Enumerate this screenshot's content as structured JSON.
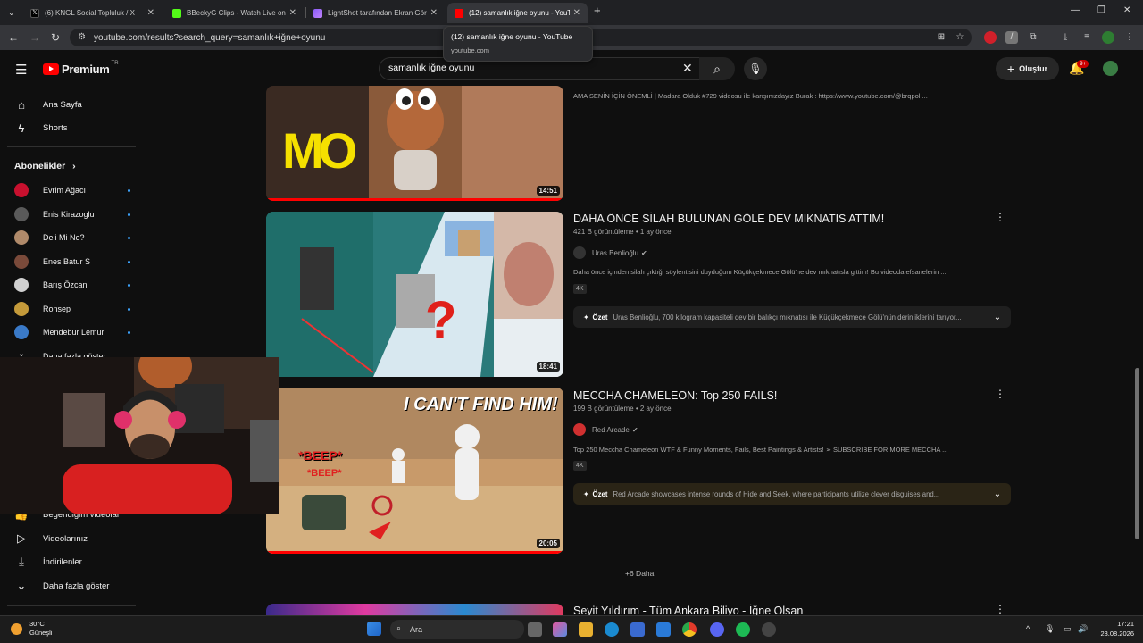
{
  "browser": {
    "tabs": [
      {
        "label": "(6) KNGL Social Topluluk / X",
        "close": "✕"
      },
      {
        "label": "BBeckyG Clips - Watch Live on K",
        "close": "✕"
      },
      {
        "label": "LightShot tarafından Ekran Görü",
        "close": "✕"
      },
      {
        "label": "(12) samanlık iğne oyunu - YouT",
        "close": "✕"
      }
    ],
    "new_tab": "+",
    "url": "youtube.com/results?search_query=samanlık+iğne+oyunu",
    "tooltip": {
      "title": "(12) samanlık iğne oyunu - YouTube",
      "domain": "youtube.com"
    }
  },
  "youtube": {
    "logo_text": "Premium",
    "logo_sup": "TR",
    "search": {
      "value": "samanlık iğne oyunu"
    },
    "create_label": "Oluştur",
    "notif_badge": "9+"
  },
  "sidebar": {
    "nav": [
      {
        "label": "Ana Sayfa",
        "icon": "home-icon"
      },
      {
        "label": "Shorts",
        "icon": "shorts-icon"
      }
    ],
    "subs_header": "Abonelikler",
    "subs": [
      {
        "name": "Evrim Ağacı",
        "color": "#c8102e"
      },
      {
        "name": "Enis Kirazoglu",
        "color": "#5a5a5a"
      },
      {
        "name": "Deli Mi Ne?",
        "color": "#b08a6a"
      },
      {
        "name": "Enes Batur S",
        "color": "#7a4a3a"
      },
      {
        "name": "Barış Özcan",
        "color": "#d0d0d0"
      },
      {
        "name": "Ronsep",
        "color": "#c49a3a"
      },
      {
        "name": "Mendebur Lemur",
        "color": "#3a7ac8"
      }
    ],
    "show_more_partial": "Daha fazla göster",
    "library": [
      {
        "label": "Beğendiğim videolar",
        "icon": "thumbs-up-icon"
      },
      {
        "label": "Videolarınız",
        "icon": "video-icon"
      },
      {
        "label": "İndirilenler",
        "icon": "download-icon"
      },
      {
        "label": "Daha fazla göster",
        "icon": "chevron-down-icon"
      }
    ]
  },
  "videos": [
    {
      "title": "",
      "meta": "",
      "channel": "",
      "desc": "AMA SENİN İÇİN ÖNEMLİ | Madara Olduk #729 videosu ile karışınızdayız Burak : https://www.youtube.com/@brqpol ...",
      "duration": "14:51"
    },
    {
      "title": "DAHA ÖNCE SİLAH BULUNAN GÖLE DEV MIKNATIS ATTIM!",
      "meta": "421 B görüntüleme • 1 ay önce",
      "channel": "Uras Benlioğlu",
      "desc": "Daha önce içinden silah çıktığı söylentisini duyduğum Küçükçekmece Gölü'ne dev mıknatısla gittim! Bu videoda efsanelerin ...",
      "badge": "4K",
      "summary_label": "Özet",
      "summary": "Uras Benlioğlu, 700 kilogram kapasiteli dev bir balıkçı mıknatısı ile Küçükçekmece Gölü'nün derinliklerini tarıyor...",
      "duration": "18:41"
    },
    {
      "title": "MECCHA CHAMELEON: Top 250 FAILS!",
      "meta": "199 B görüntüleme • 2 ay önce",
      "channel": "Red Arcade",
      "desc": "Top 250 Meccha Chameleon WTF & Funny Moments, Fails, Best Paintings & Artists! ➢ SUBSCRIBE FOR MORE MECCHA ...",
      "badge": "4K",
      "summary_label": "Özet",
      "summary": "Red Arcade showcases intense rounds of Hide and Seek, where participants utilize clever disguises and...",
      "duration": "20:05"
    },
    {
      "title": "Seyit Yıldırım - Tüm Ankara Biliyo - İğne Olsan"
    }
  ],
  "thumb_text": {
    "mo": "MO",
    "cant_find": "I CAN'T FIND HIM!",
    "beep1": "*BEEP*",
    "beep2": "*BEEP*",
    "question": "?"
  },
  "more_results": "+6 Daha",
  "taskbar": {
    "temp": "30°C",
    "weather": "Güneşli",
    "search": "Ara",
    "time": "17:21",
    "date": "23.08.2026"
  },
  "colors": {
    "accent": "#ff0000",
    "link": "#3ea6ff",
    "bg": "#0f0f0f"
  }
}
